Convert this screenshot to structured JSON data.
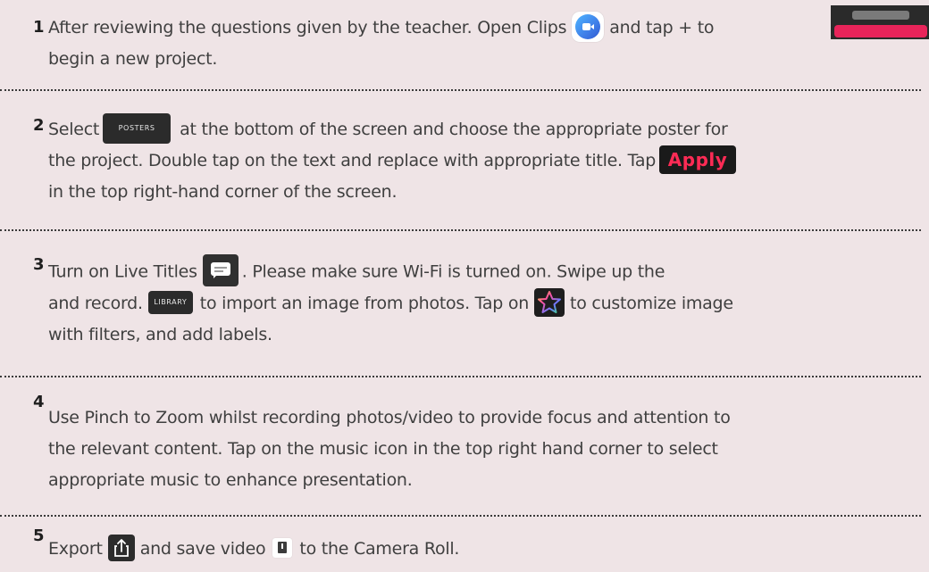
{
  "steps": [
    {
      "number": "1",
      "line1_a": "After reviewing the questions given by the teacher. Open Clips",
      "line1_b": "and tap + to",
      "line2": "begin a new project."
    },
    {
      "number": "2",
      "line1_a": "Select",
      "posters_label": "POSTERS",
      "line1_b": "at the bottom of the screen and choose the appropriate poster for",
      "line2_a": "the project. Double tap on the text and replace with appropriate title. Tap",
      "apply_label": "Apply",
      "line3": "in the top right-hand corner of the screen."
    },
    {
      "number": "3",
      "line1_a": "Turn on Live Titles",
      "line1_b": ". Please make sure Wi-Fi is turned on. Swipe up the",
      "line2_a": "and record.",
      "library_label": "LIBRARY",
      "line2_b": "to import an image from photos. Tap on",
      "line2_c": "to customize image",
      "line3": "with filters, and add labels."
    },
    {
      "number": "4",
      "line1": "Use Pinch to Zoom whilst recording photos/video to provide focus and attention to",
      "line2": "the relevant content. Tap on the music icon in the top right hand corner to select",
      "line3": "appropriate music to enhance presentation."
    },
    {
      "number": "5",
      "line1_a": "Export",
      "line1_b": "and save video",
      "line1_c": "to the Camera Roll."
    }
  ],
  "icons": {
    "clips": "clips-app-icon",
    "live_titles": "speech-bubble-icon",
    "record": "record-bar-icon",
    "star": "star-icon",
    "export": "share-export-icon",
    "save": "save-video-icon"
  },
  "colors": {
    "background": "#efe4e6",
    "apply": "#ff2b55",
    "record_red": "#e8245a",
    "clips_blue": "#3f7ee8"
  }
}
